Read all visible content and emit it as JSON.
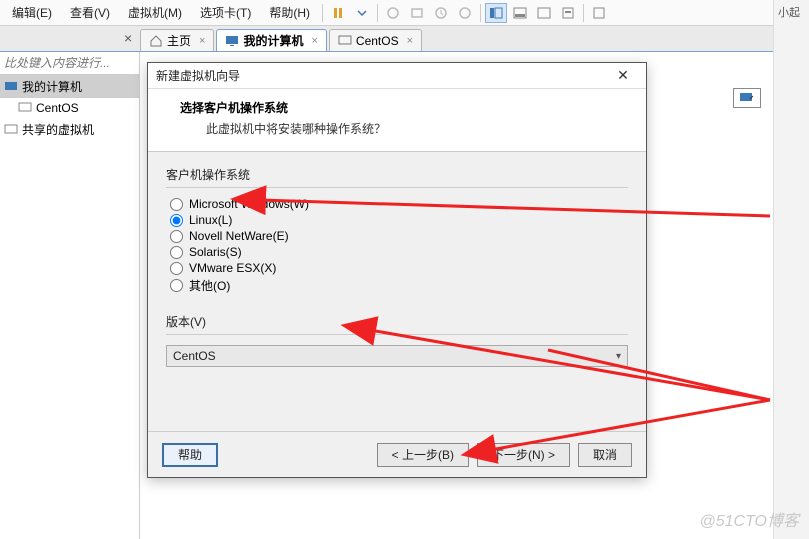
{
  "menu": {
    "items": [
      "编辑(E)",
      "查看(V)",
      "虚拟机(M)",
      "选项卡(T)",
      "帮助(H)"
    ]
  },
  "tabs": {
    "home": "主页",
    "mycomputer": "我的计算机",
    "centos": "CentOS"
  },
  "sidebar": {
    "search_placeholder": "比处键入内容进行...",
    "items": [
      "我的计算机",
      "CentOS",
      "共享的虚拟机"
    ]
  },
  "rightstrip": {
    "label": "小起"
  },
  "dialog": {
    "title": "新建虚拟机向导",
    "header_title": "选择客户机操作系统",
    "header_sub": "此虚拟机中将安装哪种操作系统？",
    "os_group_label": "客户机操作系统",
    "radios": {
      "win": "Microsoft Windows(W)",
      "linux": "Linux(L)",
      "novell": "Novell NetWare(E)",
      "solaris": "Solaris(S)",
      "esx": "VMware ESX(X)",
      "other": "其他(O)"
    },
    "selected_radio": "linux",
    "version_label": "版本(V)",
    "version_value": "CentOS",
    "buttons": {
      "help": "帮助",
      "back": "< 上一步(B)",
      "next": "下一步(N) >",
      "cancel": "取消"
    }
  },
  "watermark": "@51CTO博客"
}
